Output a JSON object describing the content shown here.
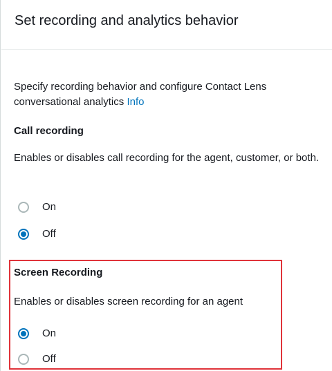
{
  "header": {
    "title": "Set recording and analytics behavior"
  },
  "intro": {
    "description": "Specify recording behavior and configure Contact Lens conversational analytics",
    "info_link": "Info"
  },
  "call_recording": {
    "title": "Call recording",
    "description": "Enables or disables call recording for the agent, customer, or both.",
    "options": [
      {
        "label": "On",
        "selected": false
      },
      {
        "label": "Off",
        "selected": true
      }
    ]
  },
  "screen_recording": {
    "title": "Screen Recording",
    "description": "Enables or disables screen recording for an agent",
    "options": [
      {
        "label": "On",
        "selected": true
      },
      {
        "label": "Off",
        "selected": false
      }
    ]
  },
  "colors": {
    "accent": "#0073bb",
    "highlight": "#e0333a"
  }
}
